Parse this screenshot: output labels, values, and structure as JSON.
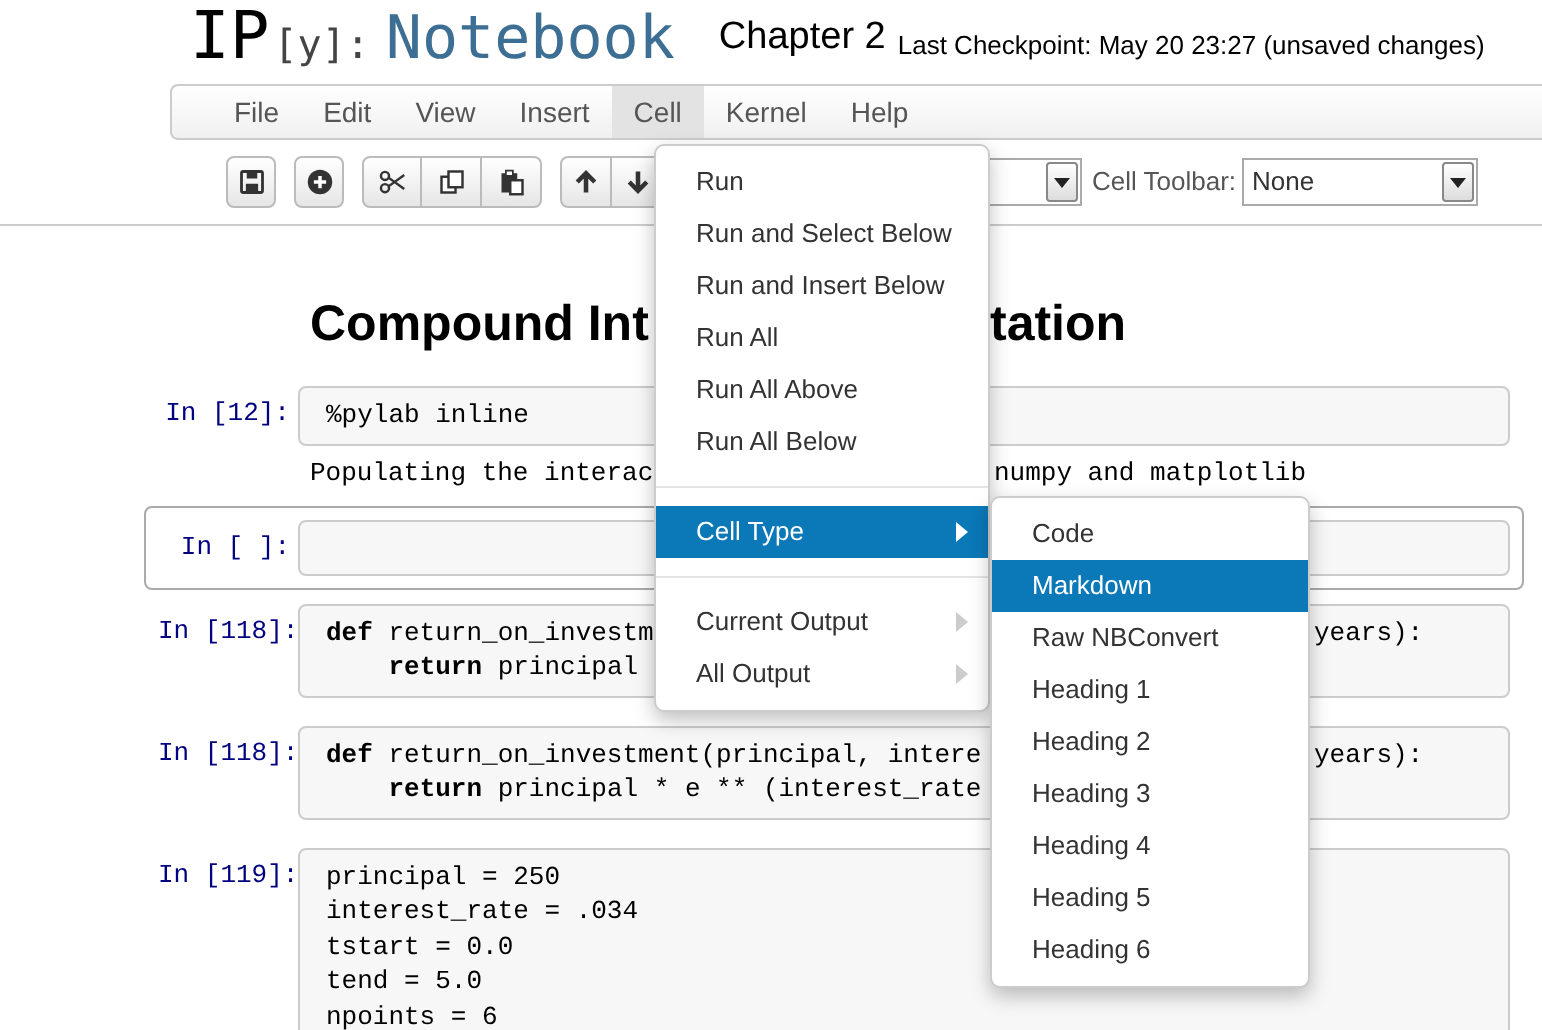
{
  "logo": {
    "ip": "IP",
    "y": "[y]:",
    "notebook": "Notebook"
  },
  "notebook_name": "Chapter 2",
  "checkpoint": "Last Checkpoint: May 20 23:27 (unsaved changes)",
  "menubar": [
    {
      "label": "File",
      "selected": false
    },
    {
      "label": "Edit",
      "selected": false
    },
    {
      "label": "View",
      "selected": false
    },
    {
      "label": "Insert",
      "selected": false
    },
    {
      "label": "Cell",
      "selected": true
    },
    {
      "label": "Kernel",
      "selected": false
    },
    {
      "label": "Help",
      "selected": false
    }
  ],
  "toolbar": {
    "groups": [
      [
        {
          "kind": "save"
        }
      ],
      [
        {
          "kind": "plus"
        }
      ],
      [
        {
          "kind": "cut"
        },
        {
          "kind": "copy"
        },
        {
          "kind": "paste"
        }
      ],
      [
        {
          "kind": "up"
        },
        {
          "kind": "down"
        }
      ]
    ],
    "cell_toolbar_label": "Cell Toolbar:",
    "cell_toolbar_value": "None"
  },
  "heading": {
    "left": "Compound Int",
    "right": "tation"
  },
  "cells": [
    {
      "prompt": "In [12]:",
      "selected": false,
      "lines": [
        {
          "text": "%pylab inline"
        }
      ],
      "output": {
        "text": "Populating the interac",
        "tail": "numpy and matplotlib"
      }
    },
    {
      "prompt": "In [ ]:",
      "selected": true
    },
    {
      "prompt": "In [118]:",
      "selected": false,
      "lines": [
        {
          "text": "**def** return_on_investm",
          "tail": "years):"
        },
        {
          "text": "    **return** principal"
        }
      ]
    },
    {
      "prompt": "In [118]:",
      "selected": false,
      "lines": [
        {
          "text": "**def** return_on_investment(principal, intere",
          "tail": "years):"
        },
        {
          "text": "    **return** principal * e ** (interest_rate"
        }
      ]
    },
    {
      "prompt": "In [119]:",
      "selected": false,
      "lines": [
        {
          "text": "principal = 250"
        },
        {
          "text": "interest_rate = .034"
        },
        {
          "text": "tstart = 0.0"
        },
        {
          "text": "tend = 5.0"
        },
        {
          "text": "npoints = 6"
        }
      ]
    }
  ],
  "cell_menu": {
    "items": [
      {
        "kind": "item",
        "label": "Run"
      },
      {
        "kind": "item",
        "label": "Run and Select Below"
      },
      {
        "kind": "item",
        "label": "Run and Insert Below"
      },
      {
        "kind": "item",
        "label": "Run All"
      },
      {
        "kind": "item",
        "label": "Run All Above"
      },
      {
        "kind": "item",
        "label": "Run All Below"
      },
      {
        "kind": "divider"
      },
      {
        "kind": "submenu",
        "label": "Cell Type",
        "selected": true
      },
      {
        "kind": "divider"
      },
      {
        "kind": "submenu",
        "label": "Current Output",
        "selected": false
      },
      {
        "kind": "submenu",
        "label": "All Output",
        "selected": false
      }
    ]
  },
  "cell_type_menu": {
    "items": [
      {
        "label": "Code",
        "selected": false
      },
      {
        "label": "Markdown",
        "selected": true
      },
      {
        "label": "Raw NBConvert",
        "selected": false
      },
      {
        "label": "Heading 1",
        "selected": false
      },
      {
        "label": "Heading 2",
        "selected": false
      },
      {
        "label": "Heading 3",
        "selected": false
      },
      {
        "label": "Heading 4",
        "selected": false
      },
      {
        "label": "Heading 5",
        "selected": false
      },
      {
        "label": "Heading 6",
        "selected": false
      }
    ]
  }
}
